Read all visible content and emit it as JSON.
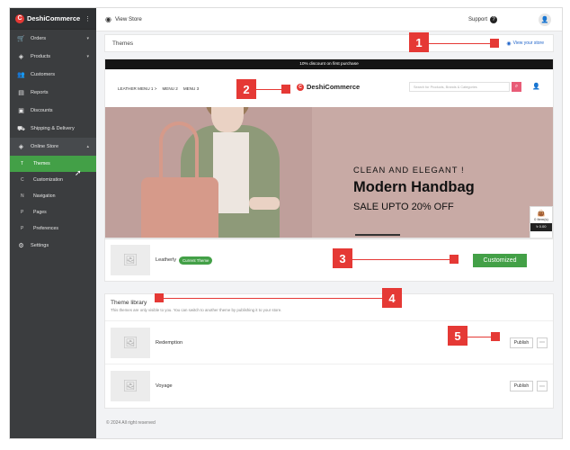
{
  "sidebar": {
    "brand": "DeshiCommerce",
    "brand_logo": "C",
    "items": [
      {
        "label": "Orders",
        "icon": "cart-icon"
      },
      {
        "label": "Products",
        "icon": "layers-icon"
      },
      {
        "label": "Customers",
        "icon": "users-icon"
      },
      {
        "label": "Reports",
        "icon": "chart-icon"
      },
      {
        "label": "Discounts",
        "icon": "tag-icon"
      },
      {
        "label": "Shipping & Delivery",
        "icon": "truck-icon"
      },
      {
        "label": "Online Store",
        "icon": "store-icon"
      }
    ],
    "sub_items": [
      {
        "letter": "T",
        "label": "Themes"
      },
      {
        "letter": "C",
        "label": "Customization"
      },
      {
        "letter": "N",
        "label": "Navigation"
      },
      {
        "letter": "P",
        "label": "Pages"
      },
      {
        "letter": "P",
        "label": "Preferences"
      }
    ],
    "settings": "Settings"
  },
  "topbar": {
    "view_store": "View Store",
    "support": "Support"
  },
  "themes_header": {
    "title": "Themes",
    "view_your_store": "View your store"
  },
  "preview": {
    "promo": "10% discount on first purchase",
    "menu1": "LEATHER MENU 1",
    "menu2": "MENU 2",
    "menu3": "MENU 3",
    "logo": "DeshiCommerce",
    "search_placeholder": "Search for Products, Brands & Categories",
    "hero_sub": "CLEAN AND ELEGANT !",
    "hero_title": "Modern Handbag",
    "hero_sale": "SALE UPTO 20% OFF",
    "cart_items": "0 Item(s)",
    "cart_total": "৳ 0.00"
  },
  "current_theme": {
    "name": "Leatherly",
    "badge": "Current Theme",
    "button": "Customized"
  },
  "library": {
    "title": "Theme library",
    "desc": "This themes are only visible to you. You can switch to another theme by publishing it to your store.",
    "rows": [
      {
        "name": "Redemption",
        "button": "Publish"
      },
      {
        "name": "Voyage",
        "button": "Publish"
      }
    ]
  },
  "footer": "© 2024 All right reserved",
  "callouts": [
    "1",
    "2",
    "3",
    "4",
    "5"
  ],
  "colors": {
    "accent": "#43a047",
    "callout": "#e53935",
    "sidebar": "#3b3d3f"
  }
}
